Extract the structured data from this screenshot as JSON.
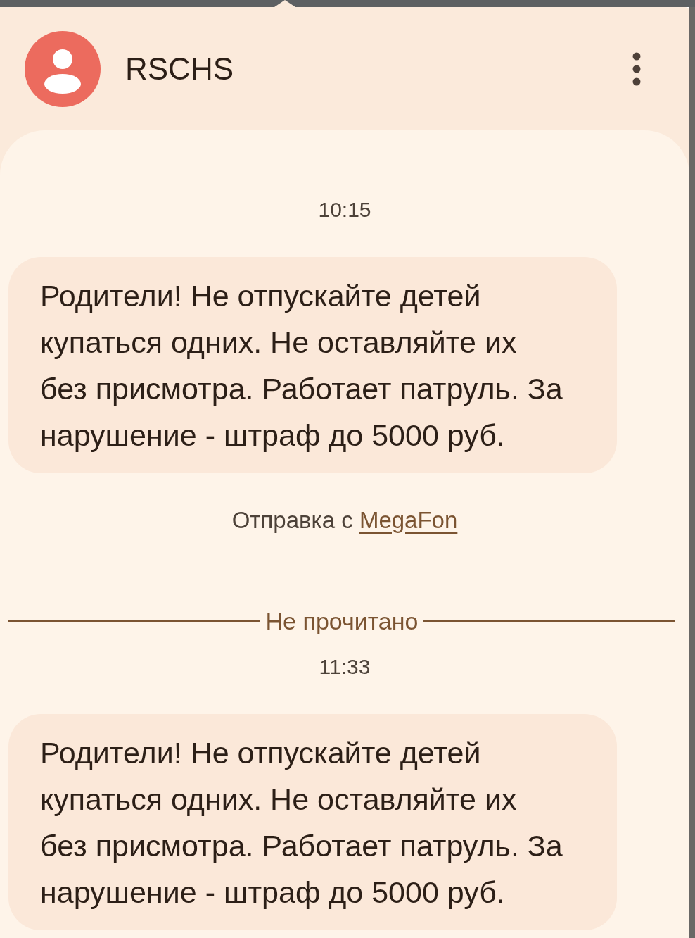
{
  "header": {
    "title": "RSCHS"
  },
  "conversation": [
    {
      "kind": "timestamp",
      "text": "10:15"
    },
    {
      "kind": "message",
      "text": "Родители! Не отпускайте детей купаться одних. Не оставляйте их без присмотра. Работает патруль. За нарушение - штраф до 5000 руб."
    },
    {
      "kind": "carrier",
      "text": "Отправка с",
      "link": "MegaFon"
    },
    {
      "kind": "divider",
      "text": "Не прочитано"
    },
    {
      "kind": "timestamp",
      "text": "11:33"
    },
    {
      "kind": "message",
      "text": "Родители! Не отпускайте детей купаться одних. Не оставляйте их без присмотра. Работает патруль. За нарушение - штраф до 5000 руб."
    }
  ]
}
